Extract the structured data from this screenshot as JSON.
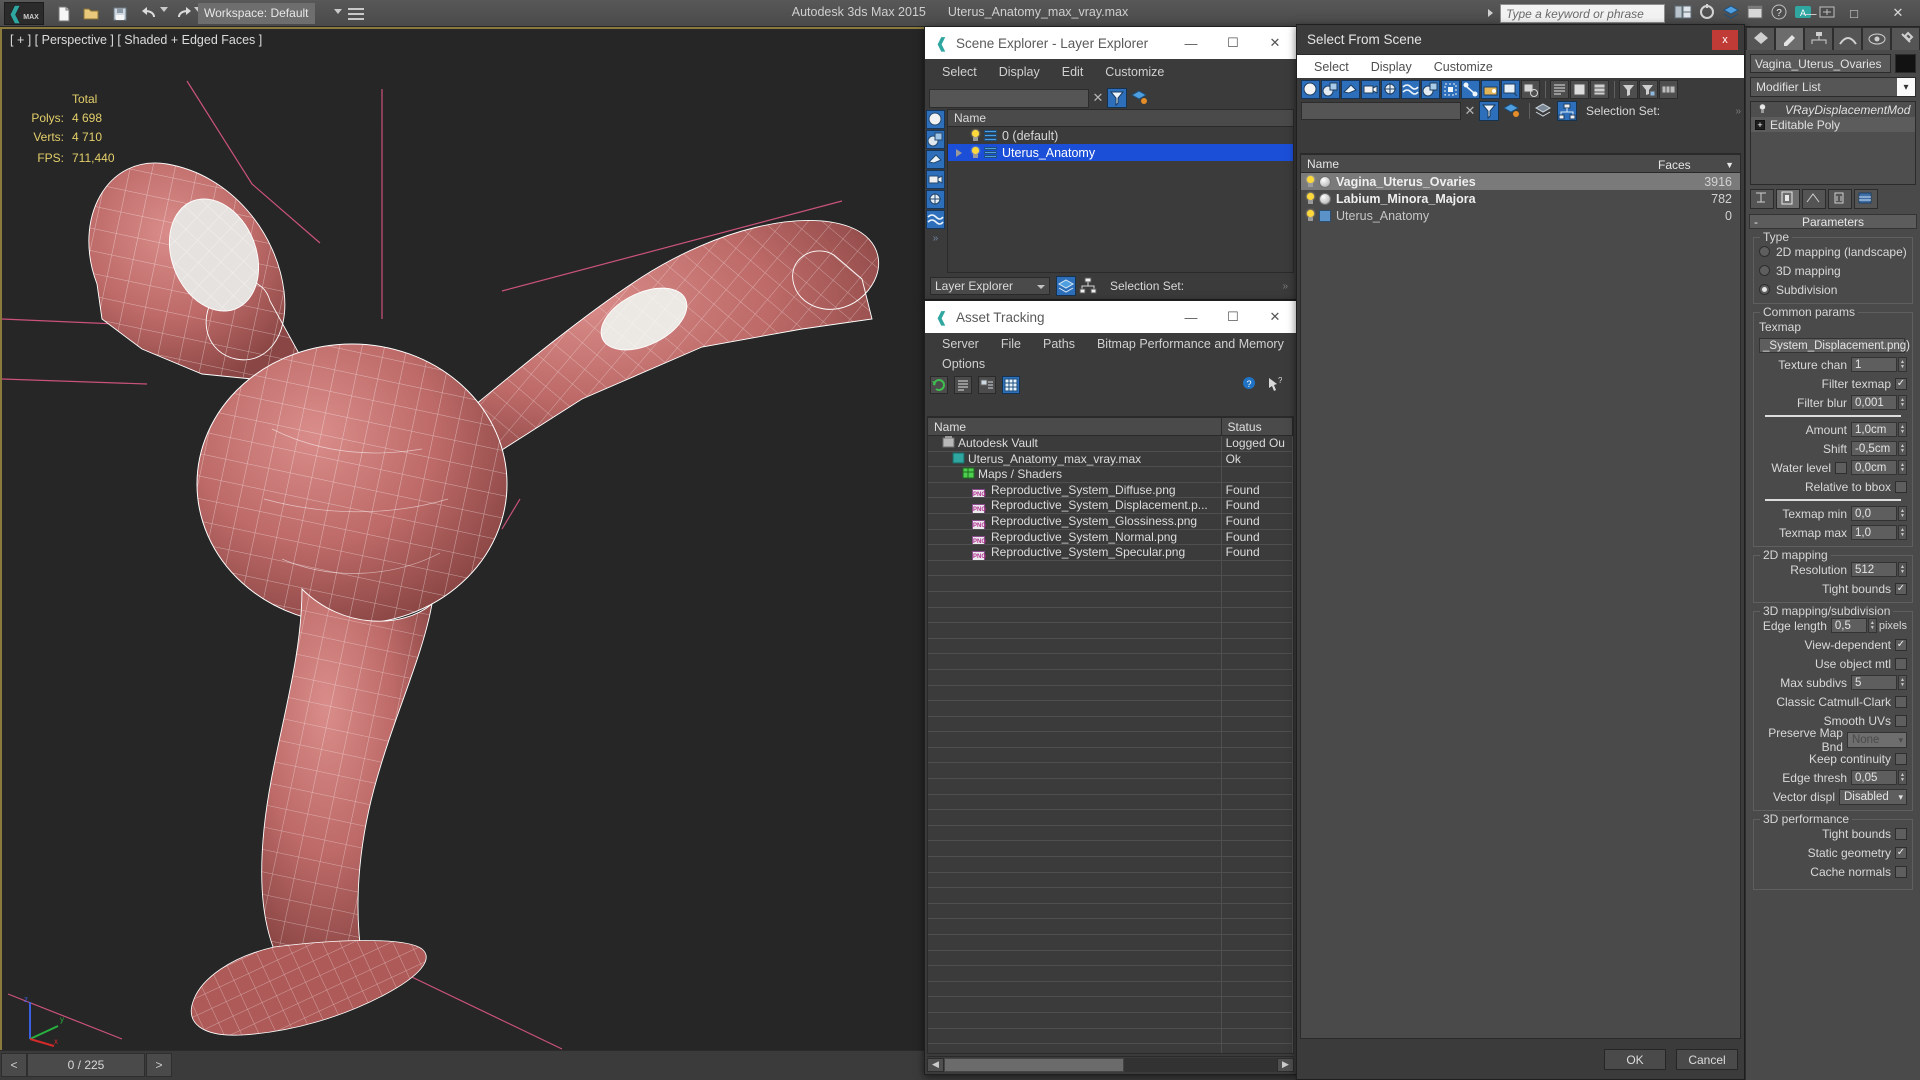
{
  "app": {
    "title": "Autodesk 3ds Max  2015",
    "file_name": "Uterus_Anatomy_max_vray.max",
    "workspace_label": "Workspace: Default",
    "search_placeholder": "Type a keyword or phrase",
    "logo_text": "MAX"
  },
  "viewport": {
    "label": "[ + ] [ Perspective ] [ Shaded + Edged Faces ]",
    "stats": {
      "total_header": "Total",
      "polys_label": "Polys:",
      "polys_value": "4 698",
      "verts_label": "Verts:",
      "verts_value": "4 710",
      "fps_label": "FPS:",
      "fps_value": "711,440"
    },
    "gizmo": {
      "x": "x",
      "y": "y",
      "z": "z"
    }
  },
  "timeline": {
    "prev": "<",
    "frame": "0 / 225",
    "next": ">"
  },
  "scene_explorer": {
    "title": "Scene Explorer - Layer Explorer",
    "menus": [
      "Select",
      "Display",
      "Edit",
      "Customize"
    ],
    "search_value": "",
    "clear_label": "✕",
    "column_header": "Name",
    "rows": [
      {
        "name": "0 (default)",
        "selected": false,
        "expandable": false
      },
      {
        "name": "Uterus_Anatomy",
        "selected": true,
        "expandable": true
      }
    ],
    "footer_combo": "Layer Explorer",
    "selection_set_label": "Selection Set:",
    "minimize": "—",
    "maximize": "☐",
    "close": "✕"
  },
  "asset_tracking": {
    "title": "Asset Tracking",
    "menus": [
      "Server",
      "File",
      "Paths",
      "Bitmap Performance and Memory",
      "Options"
    ],
    "columns": [
      "Name",
      "Status"
    ],
    "rows": [
      {
        "name": "Autodesk Vault",
        "status": "Logged Ou",
        "icon": "vault-icon",
        "indent": 1
      },
      {
        "name": "Uterus_Anatomy_max_vray.max",
        "status": "Ok",
        "icon": "max-file-icon",
        "indent": 2
      },
      {
        "name": "Maps / Shaders",
        "status": "",
        "icon": "maps-icon",
        "indent": 3
      },
      {
        "name": "Reproductive_System_Diffuse.png",
        "status": "Found",
        "icon": "png-icon",
        "indent": 4
      },
      {
        "name": "Reproductive_System_Displacement.p...",
        "status": "Found",
        "icon": "png-icon",
        "indent": 4
      },
      {
        "name": "Reproductive_System_Glossiness.png",
        "status": "Found",
        "icon": "png-icon",
        "indent": 4
      },
      {
        "name": "Reproductive_System_Normal.png",
        "status": "Found",
        "icon": "png-icon",
        "indent": 4
      },
      {
        "name": "Reproductive_System_Specular.png",
        "status": "Found",
        "icon": "png-icon",
        "indent": 4
      }
    ],
    "minimize": "—",
    "maximize": "☐",
    "close": "✕"
  },
  "select_from_scene": {
    "title": "Select From Scene",
    "close_label": "x",
    "menus": [
      "Select",
      "Display",
      "Customize"
    ],
    "search_value": "",
    "clear_label": "✕",
    "selection_set_label": "Selection Set:",
    "columns": [
      "Name",
      "Faces"
    ],
    "sort_glyph": "▼",
    "rows": [
      {
        "name": "Vagina_Uterus_Ovaries",
        "faces": "3916",
        "highlighted": true,
        "icon": "sphere-icon"
      },
      {
        "name": "Labium_Minora_Majora",
        "faces": "782",
        "highlighted": false,
        "icon": "sphere-icon"
      },
      {
        "name": "Uterus_Anatomy",
        "faces": "0",
        "highlighted": false,
        "icon": "group-icon"
      }
    ],
    "ok_label": "OK",
    "cancel_label": "Cancel"
  },
  "command_panel": {
    "object_name": "Vagina_Uterus_Ovaries",
    "modifier_list_label": "Modifier List",
    "modifier_stack": [
      {
        "label": "VRayDisplacementMod",
        "italic": true
      },
      {
        "label": "Editable Poly",
        "italic": false
      }
    ],
    "rollup": {
      "title": "Parameters",
      "minus": "-"
    },
    "type_group": {
      "label": "Type",
      "options": [
        {
          "label": "2D mapping (landscape)",
          "selected": false
        },
        {
          "label": "3D mapping",
          "selected": false
        },
        {
          "label": "Subdivision",
          "selected": true
        }
      ]
    },
    "common_params": {
      "label": "Common params",
      "texmap_label": "Texmap",
      "texmap_value": "_System_Displacement.png)",
      "texture_chan_label": "Texture chan",
      "texture_chan_value": "1",
      "filter_texmap_label": "Filter texmap",
      "filter_texmap_checked": true,
      "filter_blur_label": "Filter blur",
      "filter_blur_value": "0,001",
      "amount_label": "Amount",
      "amount_value": "1,0cm",
      "shift_label": "Shift",
      "shift_value": "-0,5cm",
      "water_level_label": "Water level",
      "water_level_checked": false,
      "water_level_value": "0,0cm",
      "relative_bbox_label": "Relative to bbox",
      "relative_bbox_checked": false,
      "texmap_min_label": "Texmap min",
      "texmap_min_value": "0,0",
      "texmap_max_label": "Texmap max",
      "texmap_max_value": "1,0"
    },
    "mapping_2d": {
      "label": "2D mapping",
      "resolution_label": "Resolution",
      "resolution_value": "512",
      "tight_bounds_label": "Tight bounds",
      "tight_bounds_checked": true
    },
    "mapping_3d": {
      "label": "3D mapping/subdivision",
      "edge_length_label": "Edge length",
      "edge_length_value": "0,5",
      "edge_length_units": "pixels",
      "view_dependent_label": "View-dependent",
      "view_dependent_checked": true,
      "use_object_mtl_label": "Use object mtl",
      "use_object_mtl_checked": false,
      "max_subdivs_label": "Max subdivs",
      "max_subdivs_value": "5",
      "catmull_label": "Classic Catmull-Clark",
      "catmull_checked": false,
      "smooth_uvs_label": "Smooth UVs",
      "smooth_uvs_checked": false,
      "preserve_map_label": "Preserve Map Bnd",
      "preserve_map_value": "None",
      "keep_continuity_label": "Keep continuity",
      "keep_continuity_checked": false,
      "edge_thresh_label": "Edge thresh",
      "edge_thresh_value": "0,05",
      "vector_displ_label": "Vector displ",
      "vector_displ_value": "Disabled"
    },
    "perf_3d": {
      "label": "3D performance",
      "tight_bounds_label": "Tight bounds",
      "tight_bounds_checked": false,
      "static_geometry_label": "Static geometry",
      "static_geometry_checked": true,
      "cache_normals_label": "Cache normals",
      "cache_normals_checked": false
    }
  },
  "colors": {
    "accent_blue": "#1c4fd8",
    "toolbar_blue": "#2d6fba",
    "stat_yellow": "#e3cf6a",
    "viewport_bg": "#262626",
    "viewport_border": "#8a7a3c",
    "mesh_red": "#b9605f",
    "close_red": "#c03b36"
  }
}
